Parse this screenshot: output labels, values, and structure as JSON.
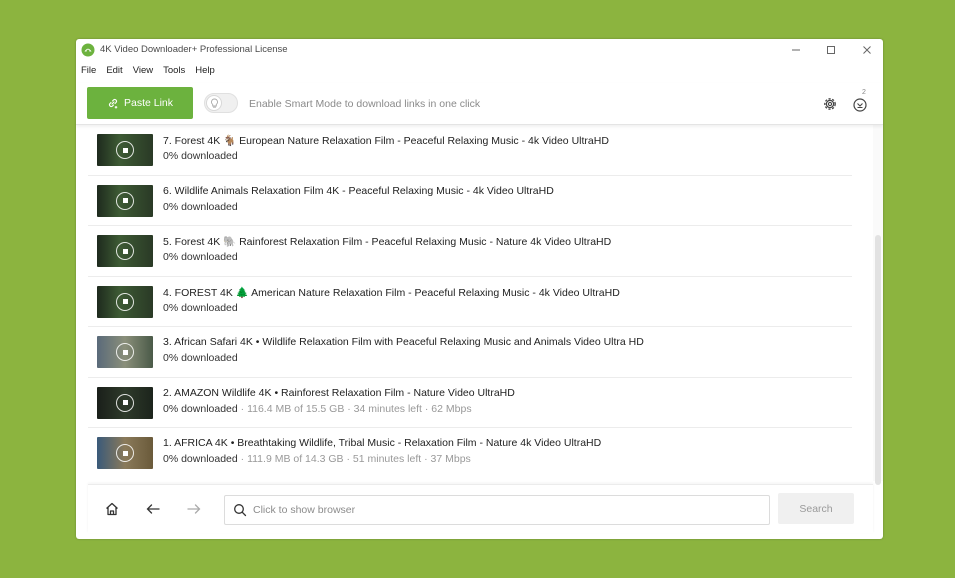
{
  "window": {
    "title": "4K Video Downloader+ Professional License",
    "controls": [
      "minimize-icon",
      "maximize-icon",
      "close-icon"
    ]
  },
  "menu": [
    "File",
    "Edit",
    "View",
    "Tools",
    "Help"
  ],
  "toolbar": {
    "paste_label": "Paste Link",
    "smart_mode_text": "Enable Smart Mode to download links in one click",
    "smart_mode_on": false,
    "activity_badge": "2",
    "accent_color": "#6cb23e"
  },
  "downloads": [
    {
      "title": "7. Forest 4K 🐐 European Nature Relaxation Film - Peaceful Relaxing Music - 4k Video UltraHD",
      "progress": "0% downloaded",
      "details": ""
    },
    {
      "title": "6. Wildlife Animals Relaxation Film 4K - Peaceful Relaxing Music - 4k Video UltraHD",
      "progress": "0% downloaded",
      "details": ""
    },
    {
      "title": "5. Forest 4K 🐘 Rainforest Relaxation Film - Peaceful Relaxing Music - Nature 4k Video UltraHD",
      "progress": "0% downloaded",
      "details": ""
    },
    {
      "title": "4. FOREST 4K 🌲 American Nature Relaxation Film - Peaceful Relaxing Music - 4k Video UltraHD",
      "progress": "0% downloaded",
      "details": ""
    },
    {
      "title": "3. African Safari 4K • Wildlife Relaxation Film with Peaceful Relaxing Music and Animals Video Ultra HD",
      "progress": "0% downloaded",
      "details": ""
    },
    {
      "title": "2. AMAZON Wildlife 4K • Rainforest Relaxation Film - Nature Video UltraHD",
      "progress": "0% downloaded",
      "details": " · 116.4 MB of 15.5 GB · 34 minutes left · 62 Mbps"
    },
    {
      "title": "1. AFRICA 4K • Breathtaking Wildlife, Tribal Music - Relaxation Film - Nature 4k Video UltraHD",
      "progress": "0% downloaded",
      "details": " · 111.9 MB of 14.3 GB · 51 minutes left · 37 Mbps"
    }
  ],
  "browser": {
    "search_placeholder": "Click to show browser",
    "search_value": "",
    "search_button": "Search"
  }
}
